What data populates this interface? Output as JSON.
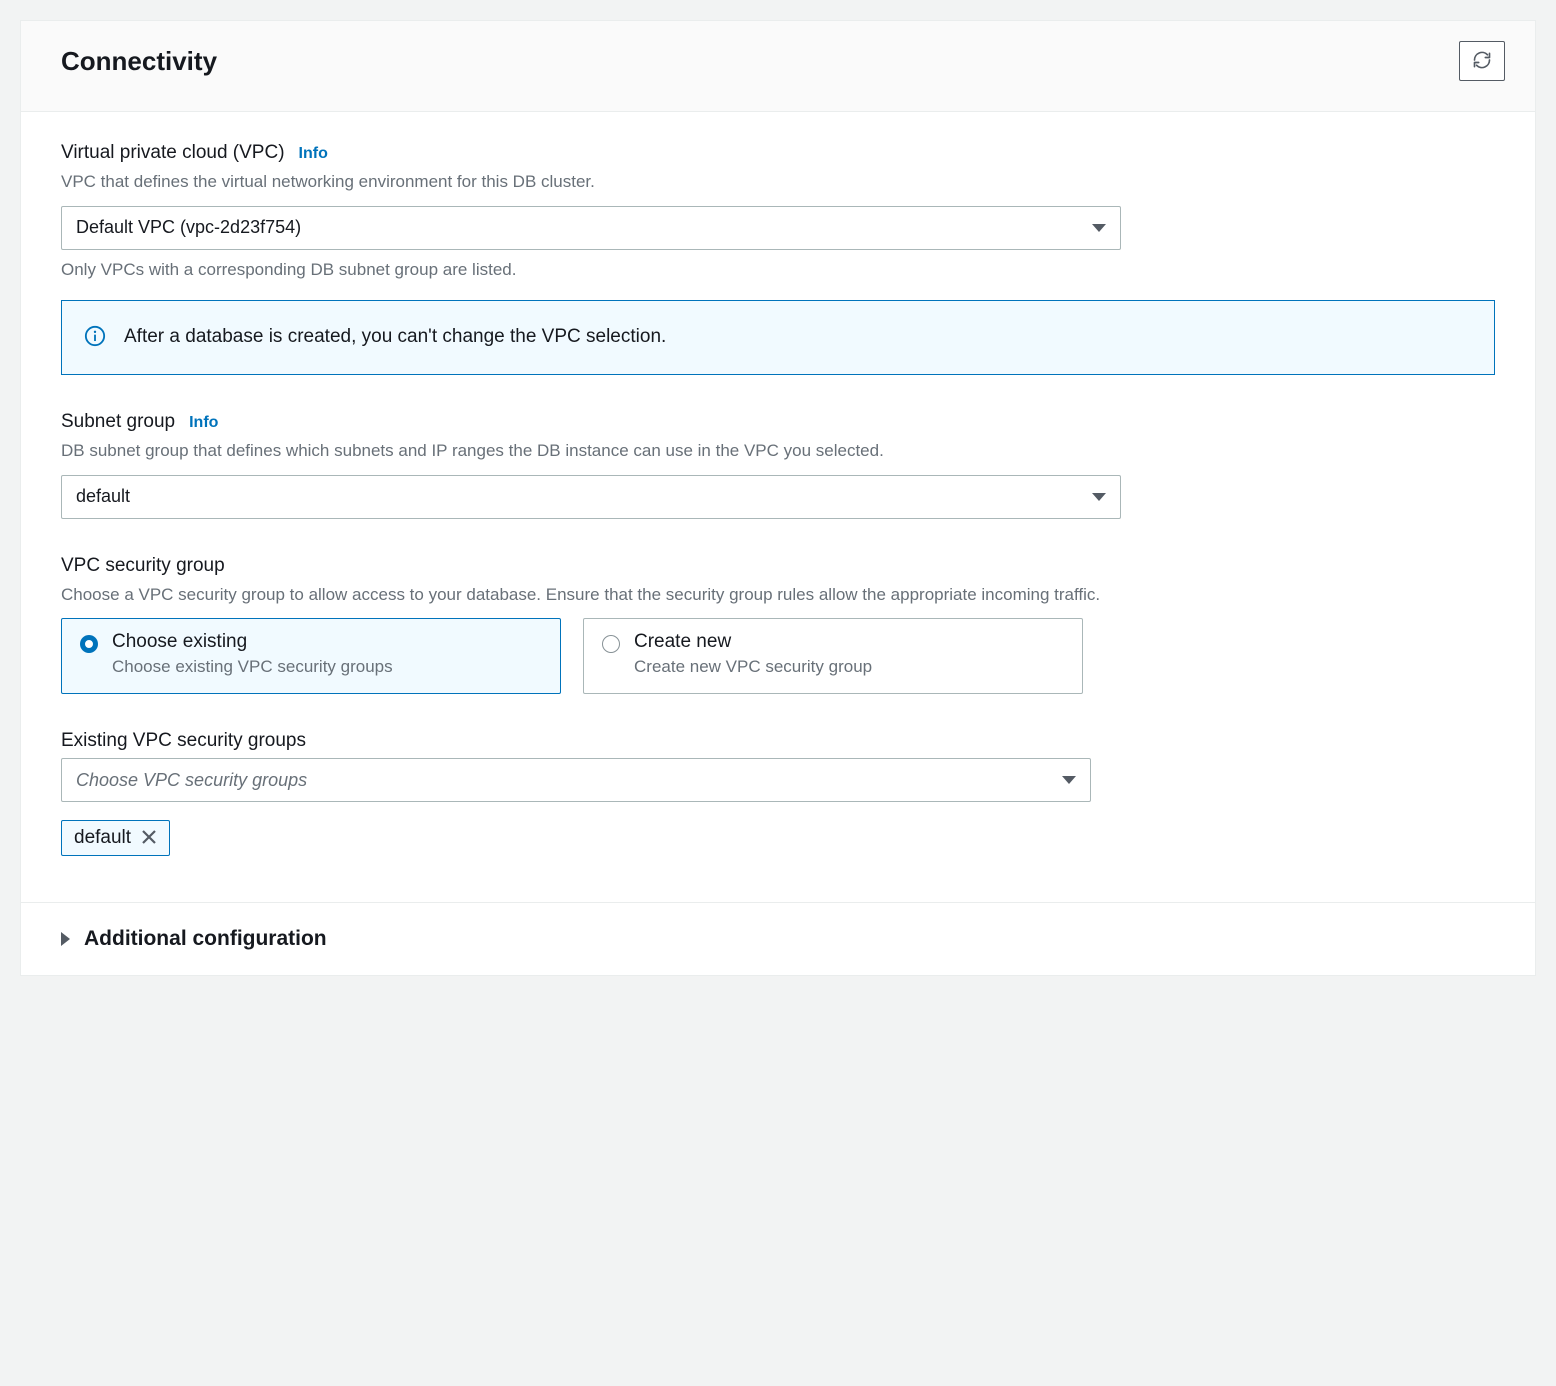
{
  "panel": {
    "title": "Connectivity"
  },
  "vpc": {
    "label": "Virtual private cloud (VPC)",
    "info": "Info",
    "desc": "VPC that defines the virtual networking environment for this DB cluster.",
    "value": "Default VPC (vpc-2d23f754)",
    "hint": "Only VPCs with a corresponding DB subnet group are listed."
  },
  "alert": {
    "text": "After a database is created, you can't change the VPC selection."
  },
  "subnet": {
    "label": "Subnet group",
    "info": "Info",
    "desc": "DB subnet group that defines which subnets and IP ranges the DB instance can use in the VPC you selected.",
    "value": "default"
  },
  "secgroup": {
    "label": "VPC security group",
    "desc": "Choose a VPC security group to allow access to your database. Ensure that the security group rules allow the appropriate incoming traffic.",
    "options": [
      {
        "title": "Choose existing",
        "desc": "Choose existing VPC security groups",
        "selected": true
      },
      {
        "title": "Create new",
        "desc": "Create new VPC security group",
        "selected": false
      }
    ]
  },
  "existing": {
    "label": "Existing VPC security groups",
    "placeholder": "Choose VPC security groups",
    "tokens": [
      "default"
    ]
  },
  "expand": {
    "label": "Additional configuration"
  }
}
